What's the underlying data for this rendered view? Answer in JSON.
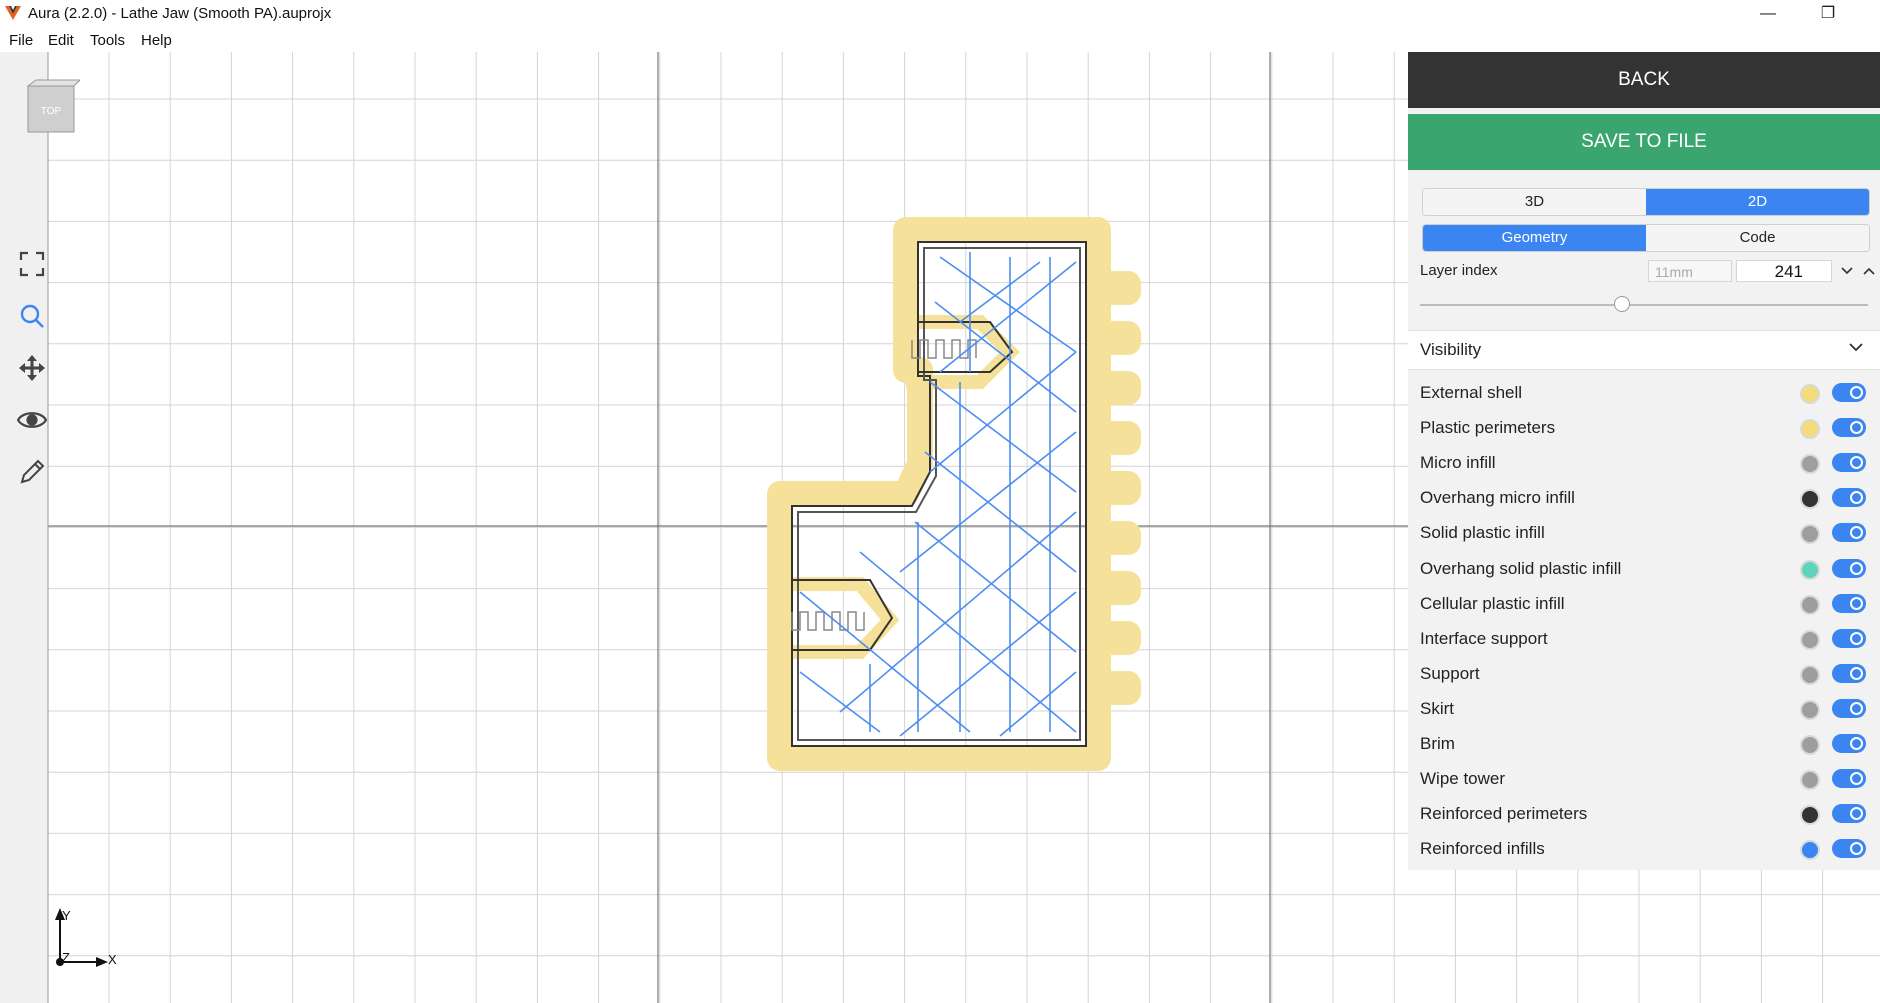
{
  "window": {
    "title": "Aura (2.2.0) - Lathe Jaw (Smooth PA).auprojx",
    "minimize": "—",
    "maximize": "❐"
  },
  "menu": [
    "File",
    "Edit",
    "Tools",
    "Help"
  ],
  "viewport": {
    "view_cube_label": "TOP",
    "axes": {
      "y": "Y",
      "z": "Z",
      "x": "X"
    },
    "tools": [
      "fit-view-icon",
      "zoom-icon",
      "move-icon",
      "visibility-icon",
      "pencil-icon"
    ]
  },
  "panel": {
    "back_label": "BACK",
    "save_label": "SAVE TO FILE",
    "view_mode": {
      "options": [
        "3D",
        "2D"
      ],
      "selected": "2D"
    },
    "content_mode": {
      "options": [
        "Geometry",
        "Code"
      ],
      "selected": "Geometry"
    },
    "layer": {
      "label": "Layer index",
      "height": "11mm",
      "index": "241",
      "slider_fraction": 0.45
    },
    "visibility": {
      "title": "Visibility",
      "items": [
        {
          "label": "External shell",
          "color": "#f5dc7a",
          "on": true
        },
        {
          "label": "Plastic perimeters",
          "color": "#f5dc7a",
          "on": true
        },
        {
          "label": "Micro infill",
          "color": "#9e9e9e",
          "on": true
        },
        {
          "label": "Overhang micro infill",
          "color": "#333333",
          "on": true
        },
        {
          "label": "Solid plastic infill",
          "color": "#9e9e9e",
          "on": true
        },
        {
          "label": "Overhang solid plastic infill",
          "color": "#5fd4bc",
          "on": true
        },
        {
          "label": "Cellular plastic infill",
          "color": "#9e9e9e",
          "on": true
        },
        {
          "label": "Interface support",
          "color": "#9e9e9e",
          "on": true
        },
        {
          "label": "Support",
          "color": "#9e9e9e",
          "on": true
        },
        {
          "label": "Skirt",
          "color": "#9e9e9e",
          "on": true
        },
        {
          "label": "Brim",
          "color": "#9e9e9e",
          "on": true
        },
        {
          "label": "Wipe tower",
          "color": "#9e9e9e",
          "on": true
        },
        {
          "label": "Reinforced perimeters",
          "color": "#333333",
          "on": true
        },
        {
          "label": "Reinforced infills",
          "color": "#3a85f2",
          "on": true
        }
      ]
    }
  }
}
